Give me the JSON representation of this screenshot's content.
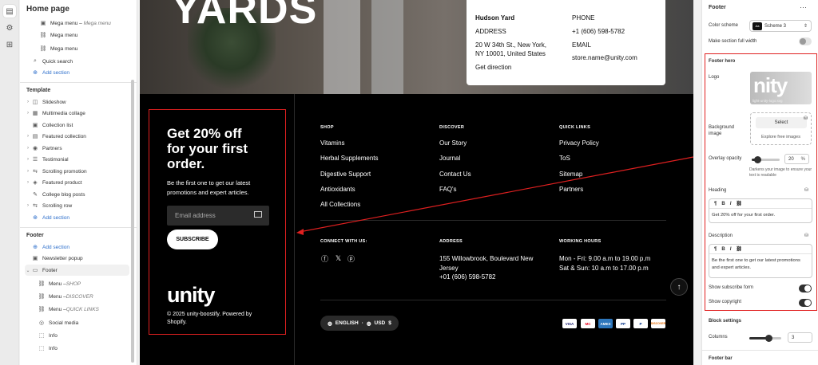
{
  "sidebar": {
    "title": "Home page",
    "rows_top": [
      {
        "label": "Mega menu",
        "sub": "Mega menu",
        "icon": "image-icon"
      },
      {
        "label": "Mega menu",
        "icon": "link-icon"
      },
      {
        "label": "Mega menu",
        "icon": "link-icon"
      },
      {
        "label": "Quick search",
        "icon": "search-icon"
      },
      {
        "label": "Add section",
        "icon": "plus-circle-icon"
      }
    ],
    "template_title": "Template",
    "template_rows": [
      "Slideshow",
      "Multimedia collage",
      "Collection list",
      "Featured collection",
      "Partners",
      "Testimonial",
      "Scrolling promotion",
      "Featured product",
      "College blog posts",
      "Scrolling row",
      "Add section"
    ],
    "footer_title": "Footer",
    "footer_rows": [
      {
        "label": "Add section"
      },
      {
        "label": "Newsletter popup"
      },
      {
        "label": "Footer"
      },
      {
        "label": "Menu – ",
        "sub": "SHOP"
      },
      {
        "label": "Menu – ",
        "sub": "DISCOVER"
      },
      {
        "label": "Menu – ",
        "sub": "QUICK LINKS"
      },
      {
        "label": "Social media"
      },
      {
        "label": "Info"
      },
      {
        "label": "Info"
      }
    ]
  },
  "preview": {
    "hero_title": "YARDS",
    "address_card": {
      "store_name": "Hudson Yard",
      "address_label": "ADDRESS",
      "address_line1": "20 W 34th St., New York,",
      "address_line2": "NY 10001, United States",
      "direction": "Get direction",
      "phone_label": "PHONE",
      "phone": "+1 (606) 598-5782",
      "email_label": "EMAIL",
      "email": "store.name@unity.com"
    },
    "footer": {
      "headline": "Get 20% off for your first order.",
      "headline_lines": [
        "Get 20% off",
        "for your first",
        "order."
      ],
      "description_lines": [
        "Be the first one to get our latest",
        "promotions and expert articles."
      ],
      "email_placeholder": "Email address",
      "subscribe": "SUBSCRIBE",
      "logo": "unity",
      "copyright_lines": [
        "© 2025 unity-boostify. Powered by",
        "Shopify."
      ],
      "columns": [
        {
          "heading": "SHOP",
          "links": [
            "Vitamins",
            "Herbal Supplements",
            "Digestive Support",
            "Antioxidants",
            "All Collections"
          ]
        },
        {
          "heading": "DISCOVER",
          "links": [
            "Our Story",
            "Journal",
            "Contact Us",
            "FAQ's"
          ]
        },
        {
          "heading": "QUICK LINKS",
          "links": [
            "Privacy Policy",
            "ToS",
            "Sitemap",
            "Partners"
          ]
        }
      ],
      "connect_heading": "CONNECT WITH US:",
      "address_heading": "ADDRESS",
      "address_lines": [
        "155 Willowbrook, Boulevard New",
        "Jersey",
        "+01 (606) 598-5782"
      ],
      "hours_heading": "WORKING HOURS",
      "hours_lines": [
        "Mon - Fri: 9.00 a.m to 19.00 p.m",
        "Sat & Sun: 10 a.m to 17.00 p.m"
      ],
      "language": "ENGLISH",
      "currency": "USD",
      "currency_symbol": "$",
      "payments": [
        "VISA",
        "MC",
        "AMEX",
        "PP",
        "P",
        "DISCOVER"
      ]
    }
  },
  "panel": {
    "title": "Footer",
    "color_scheme_label": "Color scheme",
    "color_scheme_value": "Scheme 3",
    "color_scheme_swatch": "Aa",
    "full_width_label": "Make section full width",
    "hero_title": "Footer hero",
    "logo_label": "Logo",
    "logo_filename": "light-unity-logo.svg",
    "logo_text": "nity",
    "bg_label_lines": [
      "Background",
      "image"
    ],
    "select_label": "Select",
    "explore_label": "Explore free images",
    "overlay_label": "Overlay opacity",
    "overlay_value": "20",
    "overlay_unit": "%",
    "overlay_fraction": 0.2,
    "overlay_help": "Darkens your image to ensure your text is readable",
    "heading_label": "Heading",
    "heading_value": "Get 20% off for your first order.",
    "description_label": "Description",
    "description_value": "Be the first one to get our latest promotions and expert articles.",
    "show_subscribe_label": "Show subscribe form",
    "show_copyright_label": "Show copyright",
    "block_settings_title": "Block settings",
    "columns_label": "Columns",
    "columns_value": "3",
    "columns_fraction": 0.6,
    "footer_bar_title": "Footer bar"
  },
  "colors": {
    "accent_red": "#e02020",
    "link_blue": "#2c6ecb"
  }
}
